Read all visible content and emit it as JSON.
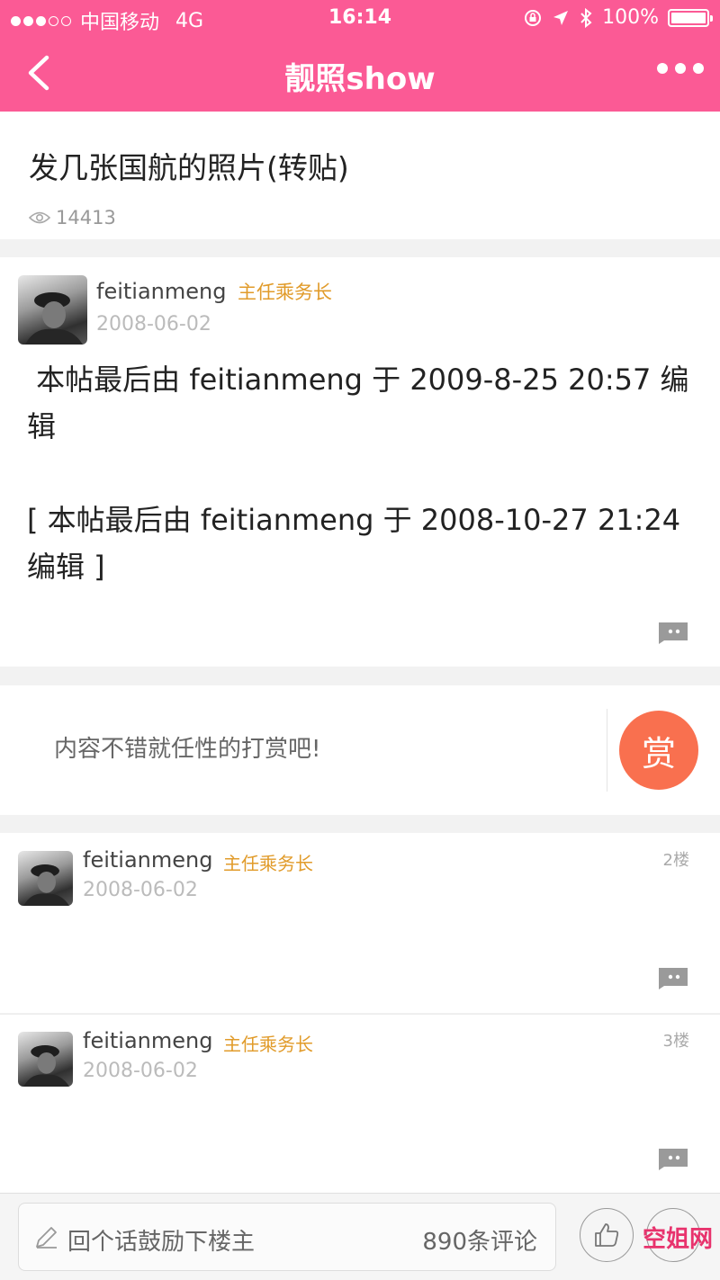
{
  "status_bar": {
    "carrier": "中国移动",
    "network": "4G",
    "time": "16:14",
    "battery": "100%"
  },
  "nav": {
    "title": "靓照show"
  },
  "post": {
    "title": "发几张国航的照片(转贴)",
    "views": "14413",
    "author": "feitianmeng",
    "rank": "主任乘务长",
    "date": "2008-06-02",
    "body": " 本帖最后由 feitianmeng 于 2009-8-25 20:57 编辑\n\n[ 本帖最后由 feitianmeng 于 2008-10-27 21:24 编辑 ]"
  },
  "reward": {
    "text": "内容不错就任性的打赏吧!",
    "button_label": "赏"
  },
  "floors": [
    {
      "author": "feitianmeng",
      "rank": "主任乘务长",
      "date": "2008-06-02",
      "floor": "2楼"
    },
    {
      "author": "feitianmeng",
      "rank": "主任乘务长",
      "date": "2008-06-02",
      "floor": "3楼"
    }
  ],
  "bottom_bar": {
    "reply_placeholder": "回个话鼓励下楼主",
    "comment_count": "890条评论",
    "watermark": "空姐网"
  },
  "colors": {
    "brand": "#fb5a95",
    "rank": "#e19b2a",
    "reward": "#f9704f"
  }
}
